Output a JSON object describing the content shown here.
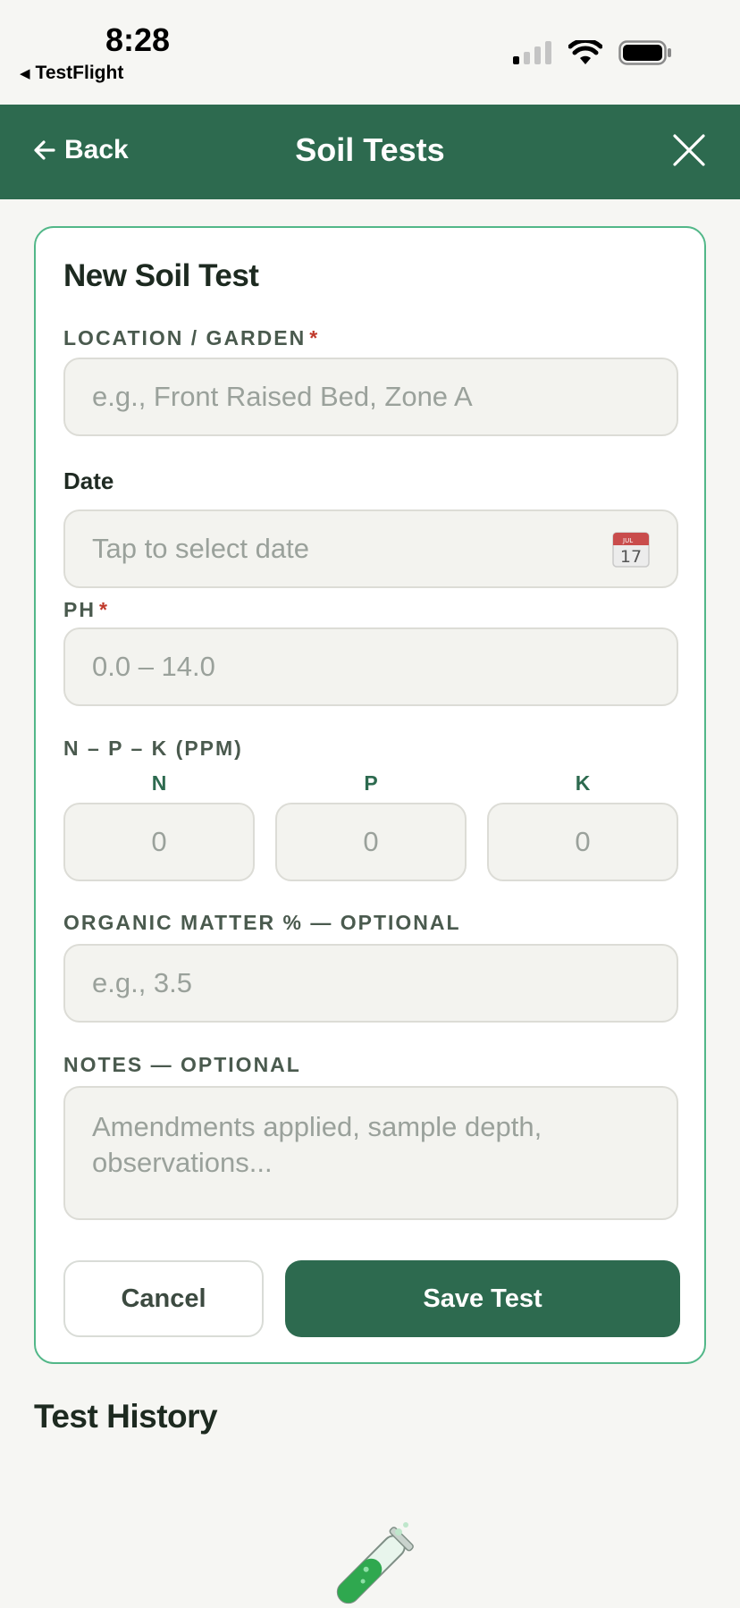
{
  "status_bar": {
    "time": "8:28",
    "back_app": "TestFlight",
    "icons": [
      "signal-icon",
      "wifi-icon",
      "battery-icon"
    ]
  },
  "nav": {
    "back_label": "Back",
    "title": "Soil Tests",
    "close_icon": "close-icon"
  },
  "form": {
    "title": "New Soil Test",
    "location": {
      "label": "LOCATION / GARDEN",
      "required_mark": "*",
      "placeholder": "e.g., Front Raised Bed, Zone A",
      "value": ""
    },
    "date": {
      "label": "Date",
      "placeholder": "Tap to select date",
      "icon": "calendar-icon",
      "calendar_day": "17",
      "calendar_month": "JUL"
    },
    "ph": {
      "label": "PH",
      "required_mark": "*",
      "placeholder": "0.0 – 14.0",
      "value": ""
    },
    "npk": {
      "label": "N – P – K (PPM)",
      "fields": [
        {
          "head": "N",
          "placeholder": "0",
          "value": ""
        },
        {
          "head": "P",
          "placeholder": "0",
          "value": ""
        },
        {
          "head": "K",
          "placeholder": "0",
          "value": ""
        }
      ]
    },
    "organic_matter": {
      "label": "ORGANIC MATTER % — OPTIONAL",
      "placeholder": "e.g., 3.5",
      "value": ""
    },
    "notes": {
      "label": "NOTES — OPTIONAL",
      "placeholder": "Amendments applied, sample depth, observations...",
      "value": ""
    },
    "cancel_label": "Cancel",
    "save_label": "Save Test"
  },
  "history": {
    "title": "Test History",
    "empty_icon": "test-tube-icon"
  },
  "colors": {
    "brand": "#2d6a4f",
    "card_border": "#52b788",
    "required": "#c0392b",
    "background": "#f6f6f3"
  }
}
